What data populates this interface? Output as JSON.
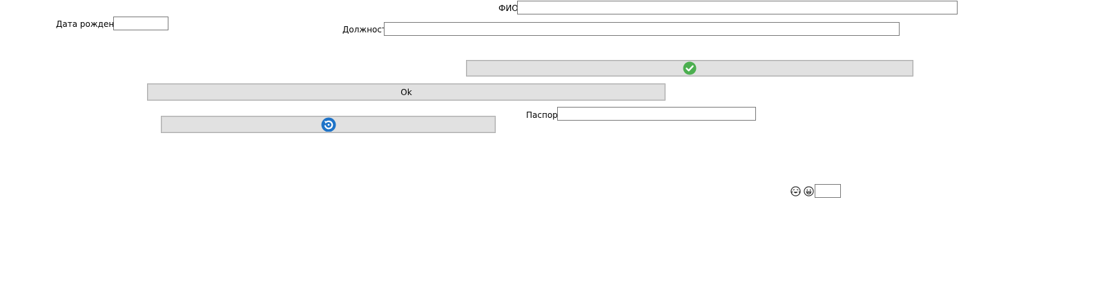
{
  "form": {
    "fio_label": "ФИО",
    "fio_value": "",
    "birth_date_label": "Дата рождения",
    "birth_date_value": "",
    "position_label": "Должность",
    "position_value": "",
    "passport_label": "Паспорт",
    "passport_value": "",
    "small_field_value": ""
  },
  "buttons": {
    "confirm_icon": "check-circle-icon",
    "ok_label": "Ok",
    "refresh_icon": "refresh-icon"
  },
  "icons": {
    "emoji_1": "crying-laughing-face-icon",
    "emoji_2": "grinning-face-icon"
  },
  "colors": {
    "button_face": "#e1e1e1",
    "field_border": "#7a7a7a",
    "check_green": "#4caf50",
    "refresh_blue": "#1e73c8"
  }
}
